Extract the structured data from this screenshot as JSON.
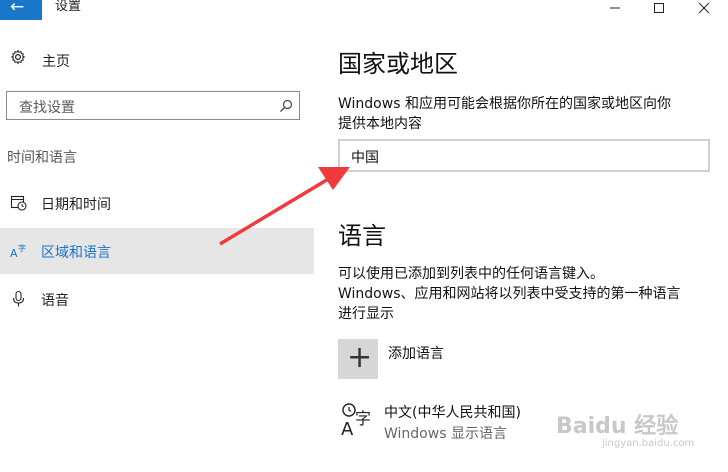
{
  "titlebar": {
    "back_icon": "arrow-left-icon",
    "title": "设置",
    "accent": "#1977c9",
    "controls": [
      "minimize-icon",
      "maximize-icon",
      "close-icon"
    ]
  },
  "sidebar": {
    "home_label": "主页",
    "search_placeholder": "查找设置",
    "section_label": "时间和语言",
    "items": [
      {
        "label": "日期和时间",
        "icon": "calendar-clock-icon"
      },
      {
        "label": "区域和语言",
        "icon": "region-language-icon",
        "selected": true
      },
      {
        "label": "语音",
        "icon": "microphone-icon"
      }
    ],
    "selected_color": "#1a73c9"
  },
  "main": {
    "country_heading": "国家或地区",
    "country_desc_line1": "Windows 和应用可能会根据你所在的国家或地区向你",
    "country_desc_line2": "提供本地内容",
    "country_value": "中国",
    "language_heading": "语言",
    "language_desc_line1": "可以使用已添加到列表中的任何语言键入。",
    "language_desc_line2": "Windows、应用和网站将以列表中受支持的第一种语言",
    "language_desc_line3": "进行显示",
    "add_language_label": "添加语言",
    "languages": [
      {
        "name": "中文(中华人民共和国)",
        "sub": "Windows 显示语言",
        "icon": "language-icon"
      }
    ]
  },
  "watermark": {
    "text": "Baidu 经验",
    "sub": "jingyan.baidu.com"
  },
  "annotation": {
    "color": "#ef3b3b"
  }
}
